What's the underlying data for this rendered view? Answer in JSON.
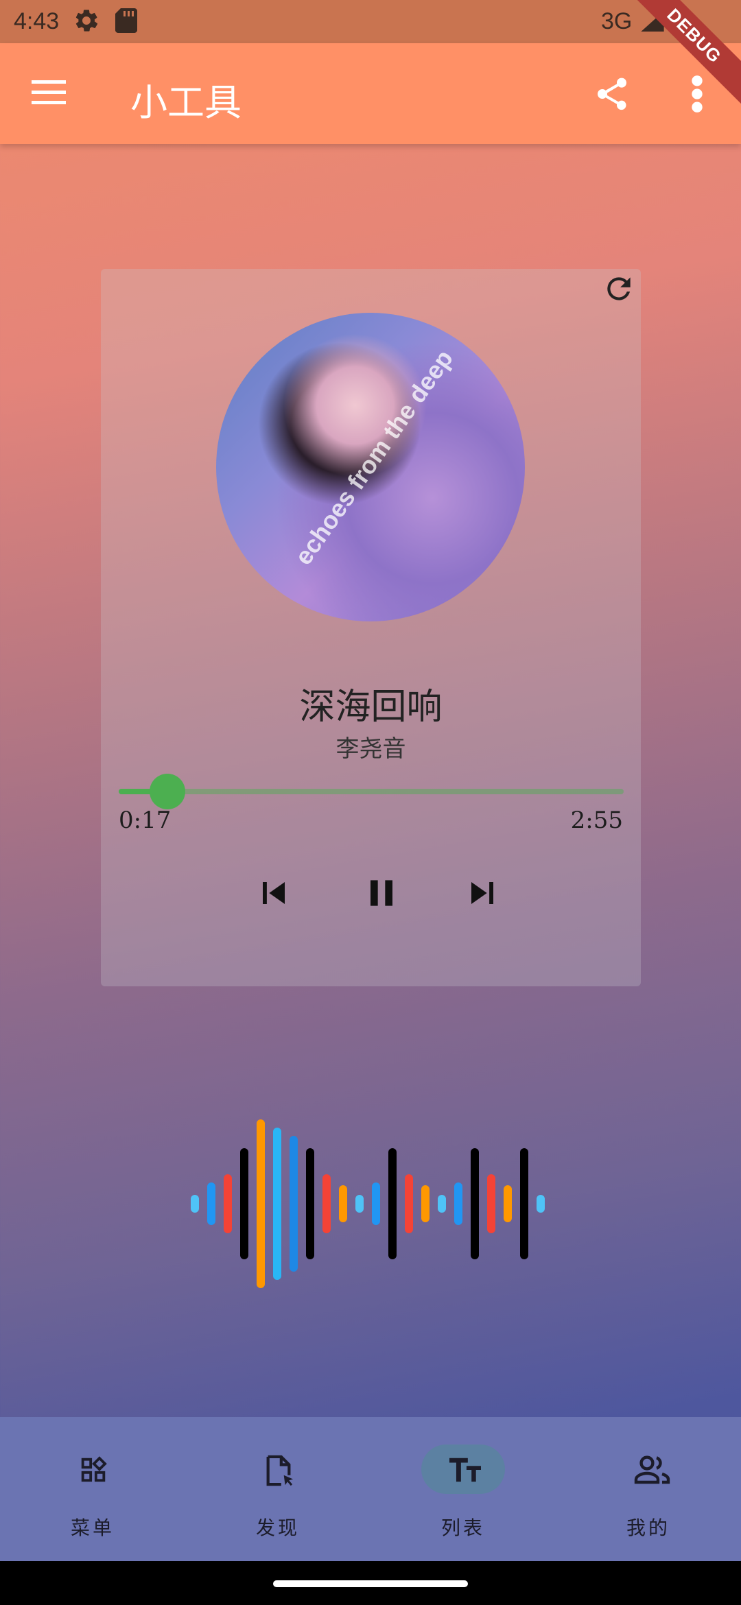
{
  "status_bar": {
    "time": "4:43",
    "network": "3G",
    "icons": [
      "gear-icon",
      "sd-card-icon",
      "signal-icon",
      "battery-icon"
    ]
  },
  "debug_banner": "DEBUG",
  "app_bar": {
    "title": "小工具",
    "icons": [
      "menu-icon",
      "share-icon",
      "more-vert-icon"
    ],
    "color": "#ff9066"
  },
  "player": {
    "title": "深海回响",
    "artist": "李尧音",
    "cover_text": "echoes from the deep",
    "current_time": "0:17",
    "total_time": "2:55",
    "progress": 0.097,
    "buffered": 0.75,
    "controls": [
      "skip-previous-icon",
      "pause-icon",
      "skip-next-icon"
    ],
    "accent": "#4caf50"
  },
  "waveform": {
    "colors": [
      "#4fc3f7",
      "#2196f3",
      "#f44336",
      "#000000",
      "#ff9800",
      "#29b6f6",
      "#1e88e5"
    ]
  },
  "bottom_nav": {
    "items": [
      {
        "label": "菜单",
        "icon": "widgets-icon"
      },
      {
        "label": "发现",
        "icon": "file-pointer-icon"
      },
      {
        "label": "列表",
        "icon": "text-fields-icon",
        "active": true
      },
      {
        "label": "我的",
        "icon": "people-icon"
      }
    ]
  }
}
